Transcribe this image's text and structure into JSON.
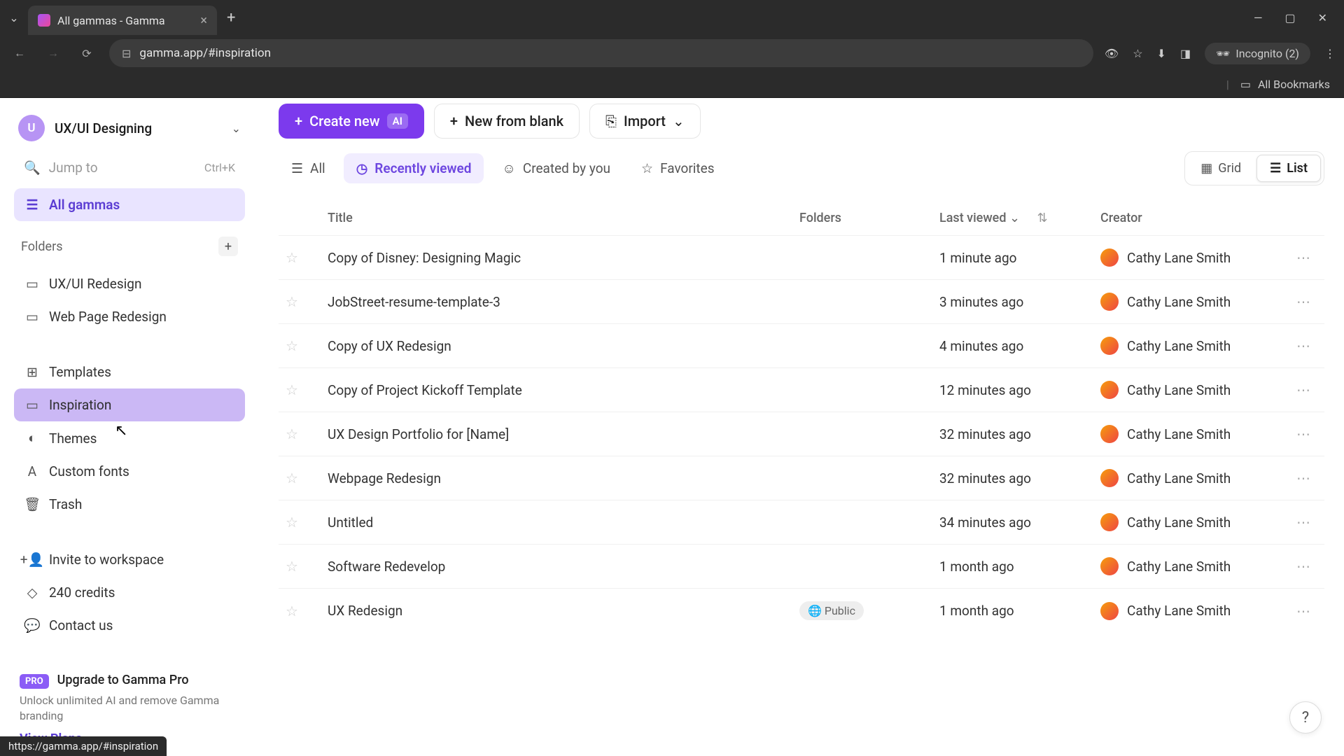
{
  "browser": {
    "tab_title": "All gammas - Gamma",
    "url": "gamma.app/#inspiration",
    "incognito": "Incognito (2)",
    "bookmarks": "All Bookmarks",
    "status_url": "https://gamma.app/#inspiration"
  },
  "sidebar": {
    "workspace_initial": "U",
    "workspace_name": "UX/UI Designing",
    "jump_placeholder": "Jump to",
    "jump_shortcut": "Ctrl+K",
    "all_gammas": "All gammas",
    "folders_label": "Folders",
    "folders": [
      {
        "label": "UX/UI Redesign"
      },
      {
        "label": "Web Page Redesign"
      }
    ],
    "nav": [
      {
        "label": "Templates",
        "icon": "⊞"
      },
      {
        "label": "Inspiration",
        "icon": "▭",
        "hover": true
      },
      {
        "label": "Themes",
        "icon": "◐"
      },
      {
        "label": "Custom fonts",
        "icon": "A"
      },
      {
        "label": "Trash",
        "icon": "🗑"
      }
    ],
    "footer": [
      {
        "label": "Invite to workspace",
        "icon": "+👤"
      },
      {
        "label": "240 credits",
        "icon": "◇"
      },
      {
        "label": "Contact us",
        "icon": "💬"
      }
    ],
    "pro": {
      "badge": "PRO",
      "title": "Upgrade to Gamma Pro",
      "desc": "Unlock unlimited AI and remove Gamma branding",
      "link": "View Plans"
    }
  },
  "actions": {
    "create": "Create new",
    "ai": "AI",
    "blank": "New from blank",
    "import": "Import"
  },
  "filters": {
    "all": "All",
    "recent": "Recently viewed",
    "created": "Created by you",
    "favorites": "Favorites",
    "grid": "Grid",
    "list": "List"
  },
  "table": {
    "headers": {
      "title": "Title",
      "folders": "Folders",
      "last_viewed": "Last viewed",
      "creator": "Creator"
    },
    "creator_name": "Cathy Lane Smith",
    "public_badge": "Public",
    "rows": [
      {
        "title": "Copy of Disney: Designing Magic",
        "viewed": "1 minute ago"
      },
      {
        "title": "JobStreet-resume-template-3",
        "viewed": "3 minutes ago"
      },
      {
        "title": "Copy of UX Redesign",
        "viewed": "4 minutes ago"
      },
      {
        "title": "Copy of Project Kickoff Template",
        "viewed": "12 minutes ago"
      },
      {
        "title": "UX Design Portfolio for [Name]",
        "viewed": "32 minutes ago"
      },
      {
        "title": "Webpage Redesign",
        "viewed": "32 minutes ago"
      },
      {
        "title": "Untitled",
        "viewed": "34 minutes ago"
      },
      {
        "title": "Software Redevelop",
        "viewed": "1 month ago"
      },
      {
        "title": "UX Redesign",
        "viewed": "1 month ago",
        "public": true
      }
    ]
  }
}
